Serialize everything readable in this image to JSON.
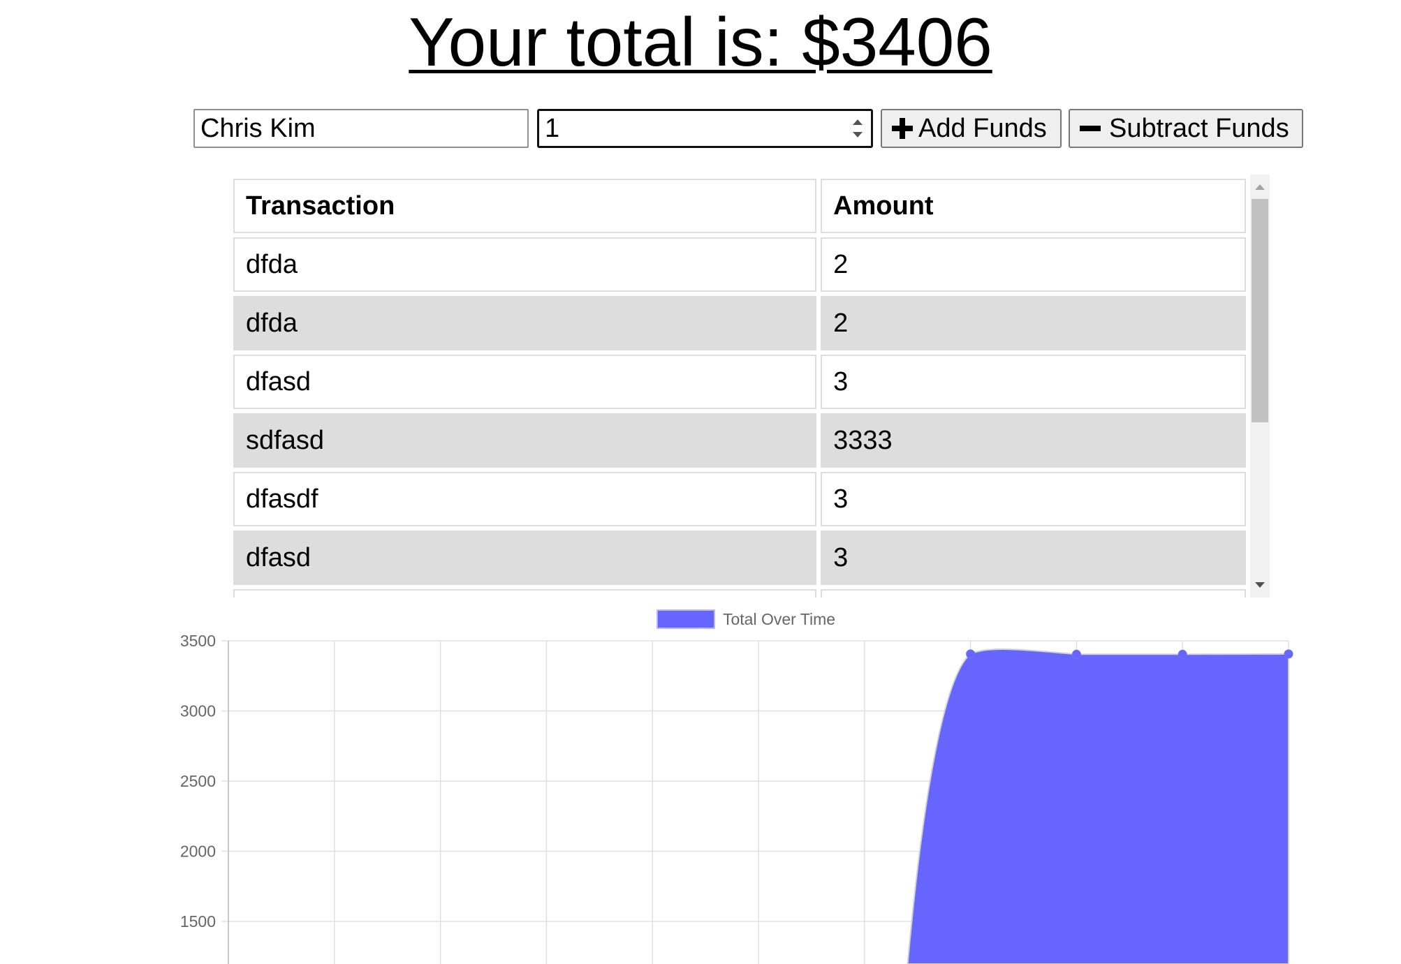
{
  "header": {
    "title": "Your total is: $3406"
  },
  "form": {
    "name_value": "Chris Kim",
    "amount_value": "1",
    "add_label": "Add Funds",
    "subtract_label": "Subtract Funds"
  },
  "table": {
    "headers": [
      "Transaction",
      "Amount"
    ],
    "rows": [
      {
        "name": "dfda",
        "amount": "2"
      },
      {
        "name": "dfda",
        "amount": "2"
      },
      {
        "name": "dfasd",
        "amount": "3"
      },
      {
        "name": "sdfasd",
        "amount": "3333"
      },
      {
        "name": "dfasdf",
        "amount": "3"
      },
      {
        "name": "dfasd",
        "amount": "3"
      },
      {
        "name": "",
        "amount": ""
      }
    ]
  },
  "colors": {
    "series_fill": "#6666ff",
    "grid": "#e0e0e0"
  },
  "chart_data": {
    "type": "area",
    "legend": [
      "Total Over Time"
    ],
    "legend_position": "top",
    "grid": true,
    "ylim": [
      1500,
      3500
    ],
    "y_ticks": [
      3500,
      3000,
      2500,
      2000,
      1500
    ],
    "series": [
      {
        "name": "Total Over Time",
        "values": [
          null,
          null,
          null,
          null,
          null,
          null,
          null,
          3406,
          3404,
          3404,
          3406
        ]
      }
    ]
  }
}
